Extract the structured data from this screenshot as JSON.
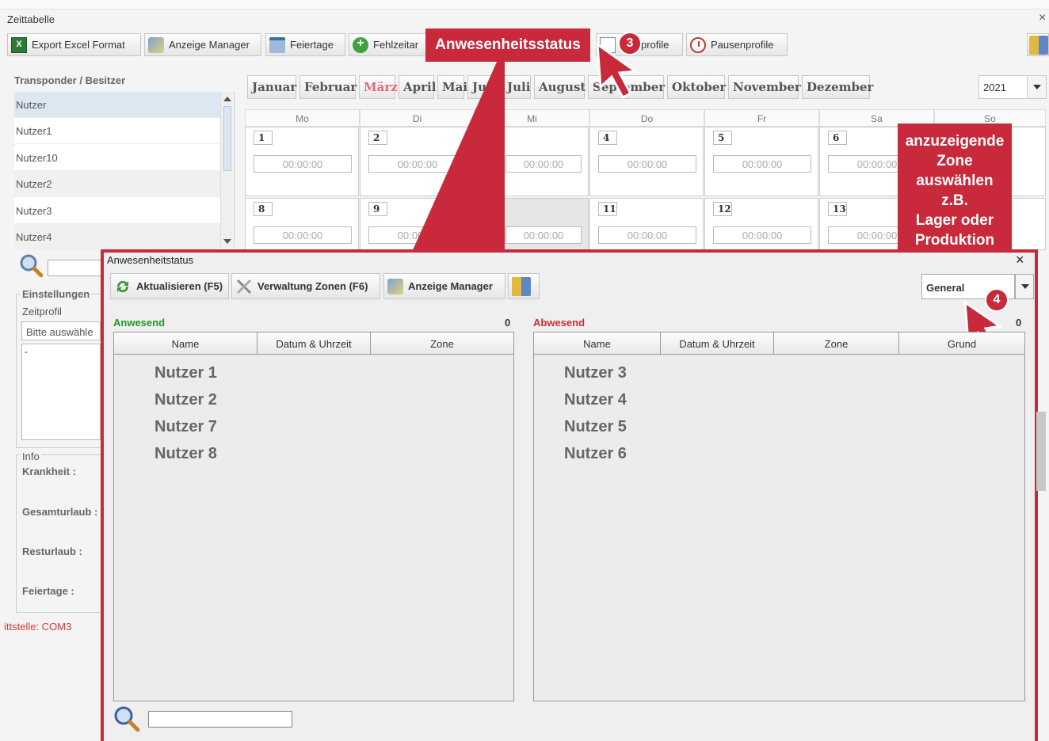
{
  "window": {
    "title": "Zeittabelle",
    "close": "×"
  },
  "toolbar": {
    "export": "Export Excel Format",
    "anzeige_manager": "Anzeige Manager",
    "feiertage": "Feiertage",
    "fehlzeit": "Fehlzeitar",
    "zeitprofile_partial": "profile",
    "pausenprofile": "Pausenprofile"
  },
  "left": {
    "header": "Transponder / Besitzer",
    "users": [
      "Nutzer",
      "Nutzer1",
      "Nutzer10",
      "Nutzer2",
      "Nutzer3",
      "Nutzer4"
    ],
    "settings_label": "Einstellungen",
    "zeitprofil_label": "Zeitprofil",
    "zeitprofil_value": "Bitte auswähle",
    "zeitprofil_area": "-",
    "info_label": "Info",
    "krankheit": "Krankheit :",
    "gesamturlaub": "Gesamturlaub :",
    "resturlaub": "Resturlaub :",
    "feiertage": "Feiertage :",
    "port": "ittstelle: COM3"
  },
  "calendar": {
    "months": [
      "Januar",
      "Februar",
      "März",
      "April",
      "Mai",
      "Jun",
      "Juli",
      "August",
      "September",
      "Oktober",
      "November",
      "Dezember"
    ],
    "active_month": "März",
    "year": "2021",
    "weekdays": [
      "Mo",
      "Di",
      "Mi",
      "Do",
      "Fr",
      "Sa",
      "So"
    ],
    "week1": [
      "1",
      "2",
      "",
      "4",
      "5",
      "6",
      ""
    ],
    "week2": [
      "8",
      "9",
      "",
      "11",
      "12",
      "13",
      ""
    ],
    "time": "00:00:00"
  },
  "callouts": {
    "step3_title": "Anwesenheitsstatus",
    "step3_badge": "3",
    "step4_lines": [
      "anzuzeigende",
      "Zone",
      "auswählen",
      "z.B.",
      "Lager oder",
      "Produktion"
    ],
    "step4_badge": "4",
    "accent": "#c8293b"
  },
  "dialog": {
    "title": "Anwesenheitstatus",
    "close": "×",
    "aktualisieren": "Aktualisieren (F5)",
    "verwaltung": "Verwaltung Zonen (F6)",
    "anzeige_manager": "Anzeige Manager",
    "zone": "General",
    "present": {
      "title": "Anwesend",
      "count": "0",
      "color": "#1e9a1e",
      "columns": [
        "Name",
        "Datum & Uhrzeit",
        "Zone"
      ],
      "rows": [
        "Nutzer 1",
        "Nutzer 2",
        "Nutzer 7",
        "Nutzer 8"
      ]
    },
    "absent": {
      "title": "Abwesend",
      "count": "0",
      "color": "#d42a2a",
      "columns": [
        "Name",
        "Datum & Uhrzeit",
        "Zone",
        "Grund"
      ],
      "rows": [
        "Nutzer 3",
        "Nutzer 4",
        "Nutzer 5",
        "Nutzer 6"
      ]
    }
  }
}
